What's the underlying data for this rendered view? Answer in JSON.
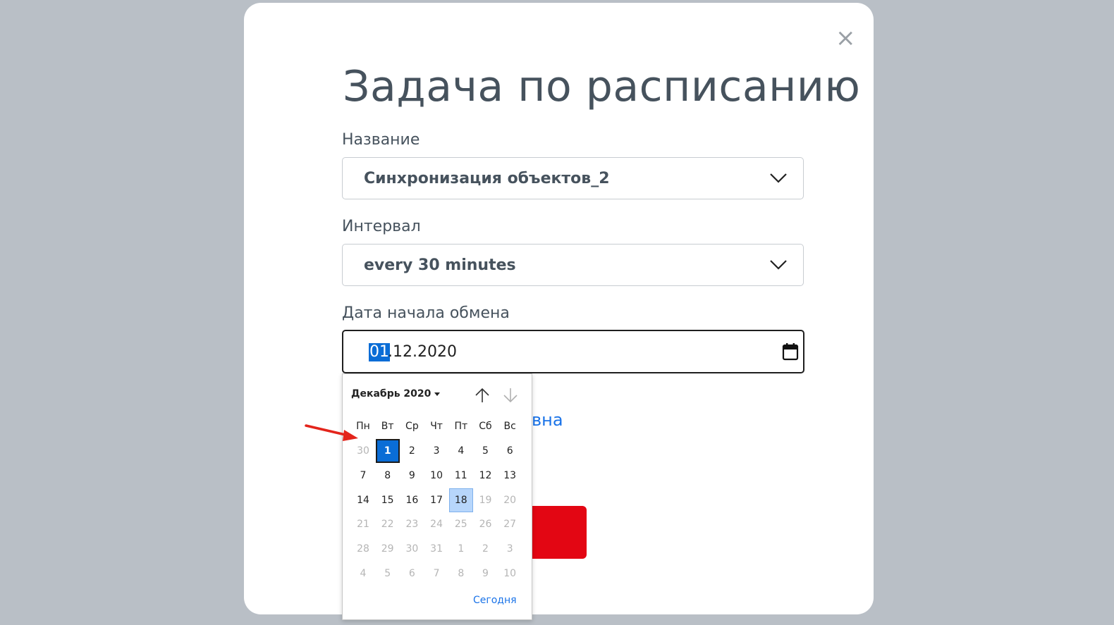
{
  "dialog": {
    "title": "Задача по расписанию",
    "close_glyph": "×",
    "name_label": "Название",
    "name_value": "Синхронизация объектов_2",
    "interval_label": "Интервал",
    "interval_value": "every 30 minutes",
    "date_label": "Дата начала обмена",
    "date_selected_segment": "01",
    "date_rest": ".12.2020",
    "partial_link_text": "вна"
  },
  "datepicker": {
    "month_label": "Декабрь 2020",
    "weekdays": [
      "Пн",
      "Вт",
      "Ср",
      "Чт",
      "Пт",
      "Сб",
      "Вс"
    ],
    "weeks": [
      [
        "30",
        "1",
        "2",
        "3",
        "4",
        "5",
        "6"
      ],
      [
        "7",
        "8",
        "9",
        "10",
        "11",
        "12",
        "13"
      ],
      [
        "14",
        "15",
        "16",
        "17",
        "18",
        "19",
        "20"
      ],
      [
        "21",
        "22",
        "23",
        "24",
        "25",
        "26",
        "27"
      ],
      [
        "28",
        "29",
        "30",
        "31",
        "1",
        "2",
        "3"
      ],
      [
        "4",
        "5",
        "6",
        "7",
        "8",
        "9",
        "10"
      ]
    ],
    "muted": [
      [
        true,
        false,
        false,
        false,
        false,
        false,
        false
      ],
      [
        false,
        false,
        false,
        false,
        false,
        false,
        false
      ],
      [
        false,
        false,
        false,
        false,
        false,
        true,
        true
      ],
      [
        true,
        true,
        true,
        true,
        true,
        true,
        true
      ],
      [
        true,
        true,
        true,
        true,
        true,
        true,
        true
      ],
      [
        true,
        true,
        true,
        true,
        true,
        true,
        true
      ]
    ],
    "selected_day": "1",
    "today_day": "18",
    "today_link": "Сегодня"
  },
  "colors": {
    "accent": "#0a6dd6",
    "danger_button": "#e30613",
    "annotation_arrow": "#e3241b",
    "backdrop": "#b9bfc6"
  },
  "icons": {
    "close": "close-icon",
    "dropdown": "chevron-down-icon",
    "calendar": "calendar-icon",
    "prev_month": "arrow-up-icon",
    "next_month": "arrow-down-icon",
    "annotation": "red-arrow-annotation"
  }
}
